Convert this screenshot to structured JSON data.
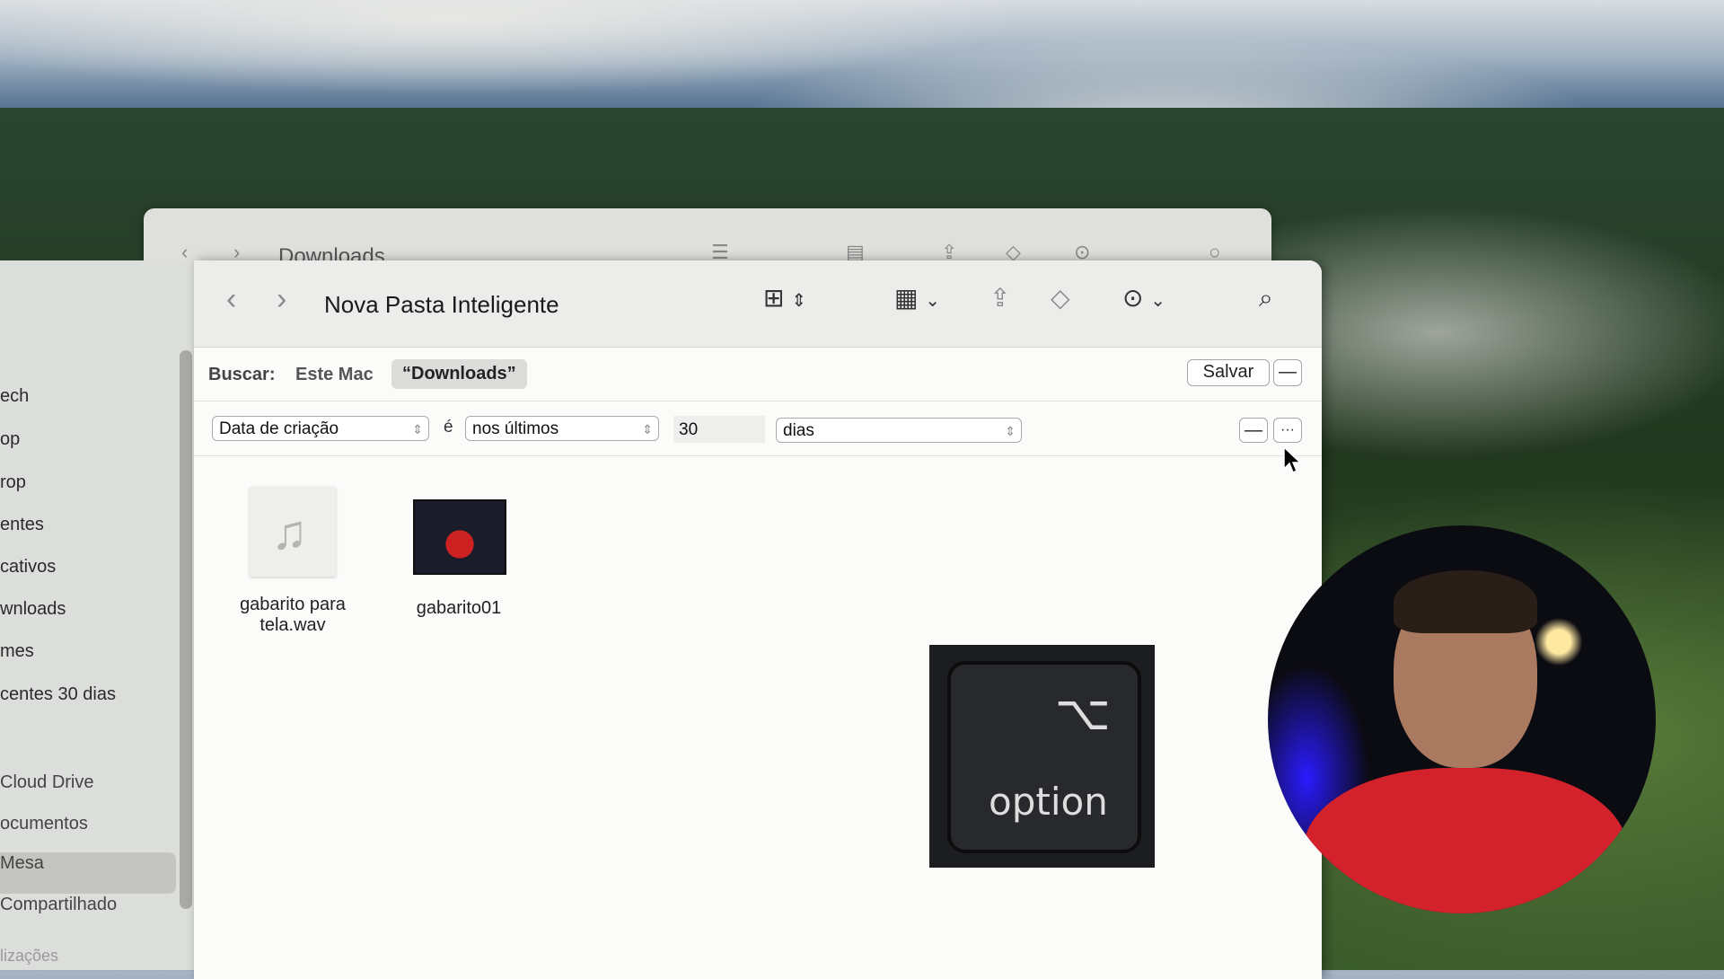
{
  "background_window": {
    "title": "Downloads"
  },
  "sidebar": {
    "items": [
      {
        "label": "ech"
      },
      {
        "label": "op"
      },
      {
        "label": "rop"
      },
      {
        "label": "entes"
      },
      {
        "label": "cativos"
      },
      {
        "label": "wnloads",
        "selected": true
      },
      {
        "label": "mes"
      },
      {
        "label": "centes 30 dias"
      },
      {
        "label": "Cloud Drive"
      },
      {
        "label": "ocumentos"
      },
      {
        "label": "Mesa"
      },
      {
        "label": "Compartilhado"
      }
    ],
    "section_label": "lizações"
  },
  "window": {
    "title": "Nova Pasta Inteligente",
    "toolbar": {
      "back_icon": "chevron-left-icon",
      "forward_icon": "chevron-right-icon",
      "view_icon": "grid-view-icon",
      "group_icon": "group-by-icon",
      "share_icon": "share-icon",
      "tag_icon": "tag-icon",
      "more_icon": "ellipsis-circle-icon",
      "search_icon": "search-icon"
    },
    "scope": {
      "label": "Buscar:",
      "option_this_mac": "Este Mac",
      "option_folder": "“Downloads”",
      "save_label": "Salvar",
      "remove_label": "—"
    },
    "criteria": {
      "attribute": "Data de criação",
      "connector": "é",
      "operator": "nos últimos",
      "value": "30",
      "unit": "dias",
      "remove_label": "—",
      "more_label": "···"
    },
    "files": [
      {
        "name": "gabarito para tela.wav",
        "line1": "gabarito para",
        "line2": "tela.wav",
        "kind": "audio"
      },
      {
        "name": "gabarito01",
        "kind": "video"
      }
    ]
  },
  "overlay": {
    "key_symbol": "⌥",
    "key_label": "option"
  }
}
